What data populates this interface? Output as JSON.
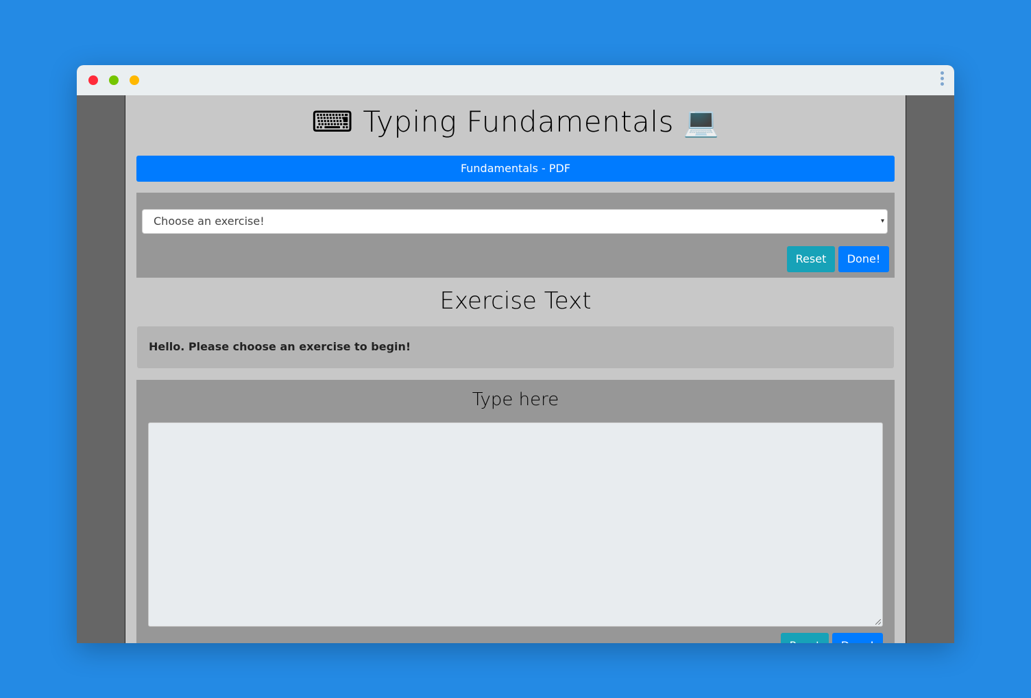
{
  "app": {
    "title": "⌨ Typing Fundamentals 💻"
  },
  "header": {
    "pdf_button_label": "Fundamentals - PDF"
  },
  "exercise_selector": {
    "selected_value": "Choose an exercise!",
    "reset_label": "Reset",
    "done_label": "Done!"
  },
  "exercise_text": {
    "heading": "Exercise Text",
    "message": "Hello. Please choose an exercise to begin!"
  },
  "typing_area": {
    "heading": "Type here",
    "value": "",
    "reset_label": "Reset",
    "done_label": "Done!"
  },
  "colors": {
    "background": "#248ae4",
    "primary": "#007bff",
    "info": "#17a2b8",
    "panel": "#979797",
    "page": "#c8c8c8"
  },
  "icons": [
    "keyboard-icon",
    "laptop-icon",
    "chevron-down-icon",
    "kebab-menu-icon"
  ]
}
